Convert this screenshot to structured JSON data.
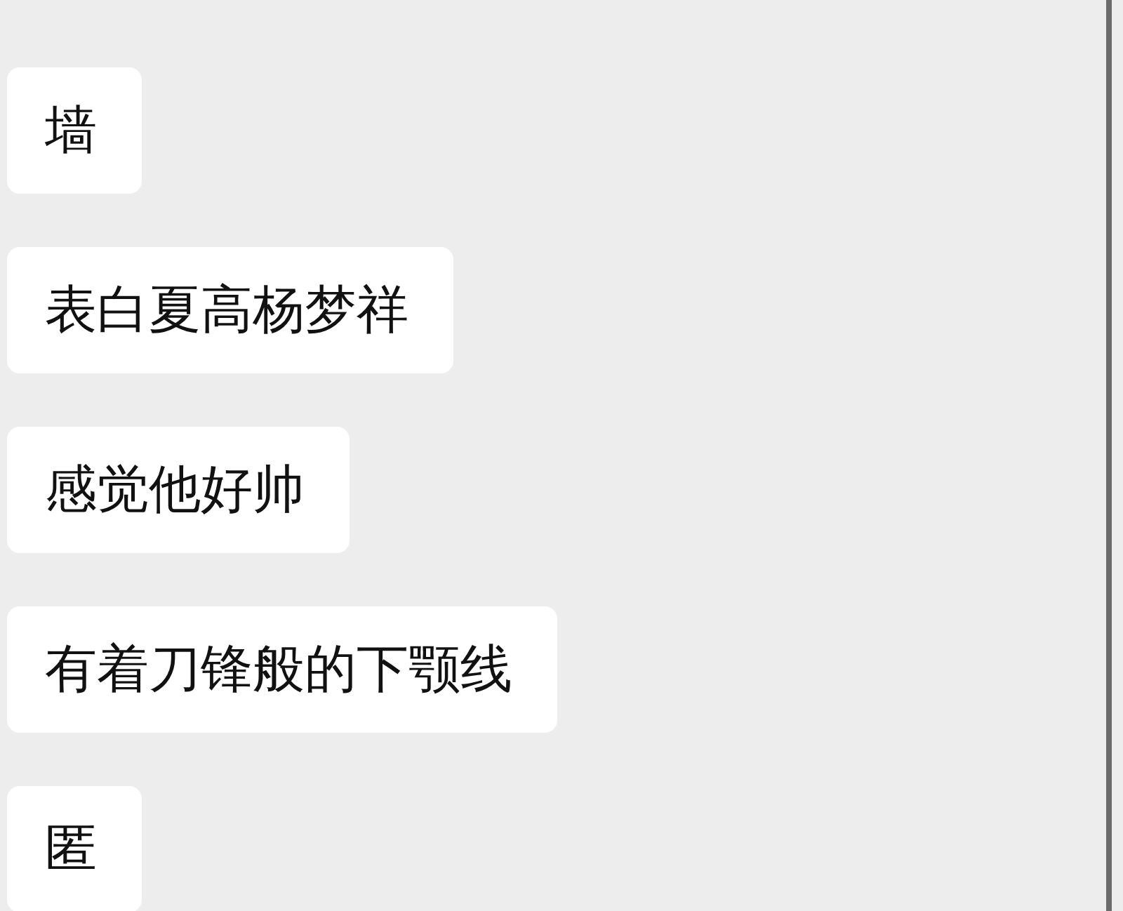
{
  "messages": [
    {
      "text": "墙"
    },
    {
      "text": "表白夏高杨梦祥"
    },
    {
      "text": "感觉他好帅"
    },
    {
      "text": "有着刀锋般的下颚线"
    },
    {
      "text": "匿"
    }
  ]
}
